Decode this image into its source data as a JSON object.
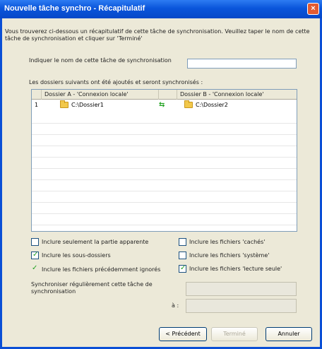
{
  "window": {
    "title": "Nouvelle tâche synchro - Récapitulatif",
    "close_label": "×"
  },
  "intro": "Vous trouverez ci-dessous un récapitulatif de cette tâche de synchronisation. Veuillez taper le nom de cette tâche de synchronisation et cliquer sur 'Terminé'",
  "name_field": {
    "label": "Indiquer le nom de cette tâche de synchronisation",
    "value": ""
  },
  "folders_caption": "Les dossiers suivants ont été ajoutés et seront synchronisés :",
  "grid": {
    "headers": [
      "",
      "Dossier A - 'Connexion locale'",
      "",
      "Dossier B - 'Connexion locale'"
    ],
    "rows": [
      {
        "num": "1",
        "a": "C:\\Dossier1",
        "b": "C:\\Dossier2"
      }
    ]
  },
  "options": {
    "only_selected": {
      "label": "Inclure seulement la partie apparente",
      "checked": false
    },
    "subfolders": {
      "label": "Inclure les sous-dossiers",
      "checked": true
    },
    "ignored_files": {
      "label": "Inclure les fichiers précédemment ignorés",
      "checked": true
    },
    "hidden_files": {
      "label": "Inclure les fichiers 'cachés'",
      "checked": false
    },
    "system_files": {
      "label": "Inclure les fichiers 'système'",
      "checked": false
    },
    "readonly_files": {
      "label": "Inclure les fichiers 'lecture seule'",
      "checked": true
    }
  },
  "schedule": {
    "label": "Synchroniser régulièrement cette tâche de synchronisation",
    "at_label": "à :",
    "field1": "",
    "field2": ""
  },
  "buttons": {
    "back": "< Précédent",
    "finish": "Terminé",
    "cancel": "Annuler"
  }
}
